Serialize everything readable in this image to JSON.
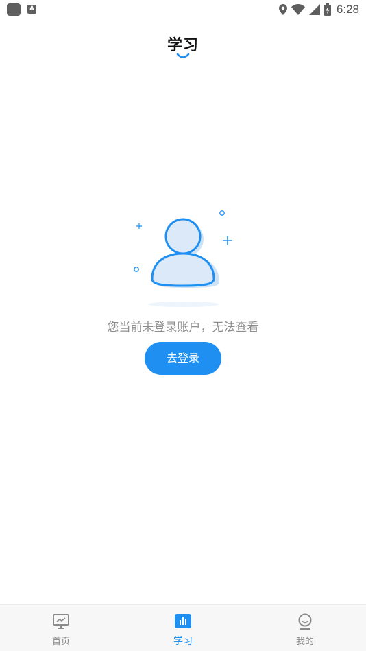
{
  "status_bar": {
    "time": "6:28",
    "notification_icons": [
      "app-square-icon",
      "a-letter-icon"
    ],
    "a_icon_letter": "A",
    "system_icons": [
      "location-icon",
      "wifi-icon",
      "cellular-signal-icon",
      "battery-charging-icon"
    ]
  },
  "header": {
    "title": "学习"
  },
  "empty_state": {
    "illustration": "user-avatar-illustration",
    "message": "您当前未登录账户，无法查看",
    "login_button_label": "去登录"
  },
  "bottom_nav": {
    "items": [
      {
        "label": "首页",
        "icon": "monitor-home-icon",
        "active": false
      },
      {
        "label": "学习",
        "icon": "chart-study-icon",
        "active": true
      },
      {
        "label": "我的",
        "icon": "profile-icon",
        "active": false
      }
    ]
  },
  "colors": {
    "accent": "#1f8ff2",
    "inactive_text": "#8a8a8a",
    "message_text": "#8f8f8f",
    "nav_background": "#f7f7f7"
  }
}
